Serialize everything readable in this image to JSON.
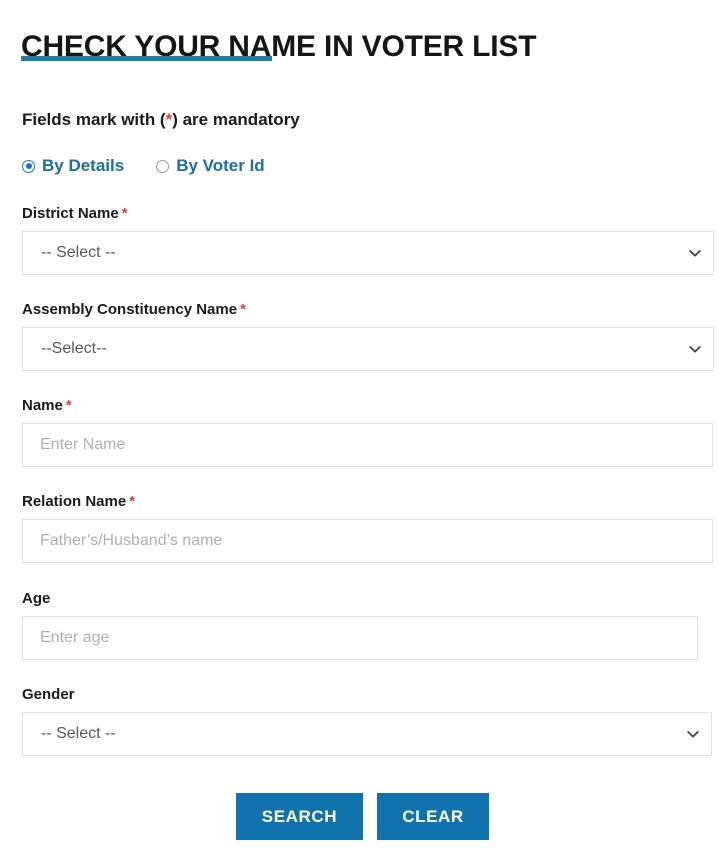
{
  "page": {
    "title": "CHECK YOUR NAME IN VOTER LIST",
    "accent_color": "#1b7fa8",
    "link_color": "#1c6ea4",
    "required_color": "#e03c3c",
    "button_color": "#1073ad"
  },
  "note": {
    "prefix": "Fields mark with (",
    "star": "*",
    "suffix": ") are mandatory"
  },
  "search_mode": {
    "options": [
      {
        "label": "By Details",
        "checked": true
      },
      {
        "label": "By Voter Id",
        "checked": false
      }
    ]
  },
  "form": {
    "fields": [
      {
        "key": "district",
        "label": "District Name",
        "required": true,
        "required_mark": "*",
        "type": "select",
        "value": "-- Select --",
        "icon": "chevron-down-icon"
      },
      {
        "key": "assembly",
        "label": "Assembly Constituency Name",
        "required": true,
        "required_mark": "*",
        "type": "select",
        "value": "--Select--",
        "icon": "chevron-down-icon"
      },
      {
        "key": "name",
        "label": "Name",
        "required": true,
        "required_mark": "*",
        "type": "text",
        "placeholder": "Enter Name",
        "value": ""
      },
      {
        "key": "relation",
        "label": "Relation Name",
        "required": true,
        "required_mark": "*",
        "type": "text",
        "placeholder": "Father’s/Husband’s name",
        "value": ""
      },
      {
        "key": "age",
        "label": "Age",
        "required": false,
        "required_mark": "",
        "type": "text",
        "placeholder": "Enter age",
        "value": ""
      },
      {
        "key": "gender",
        "label": "Gender",
        "required": false,
        "required_mark": "",
        "type": "select",
        "value": "-- Select --",
        "icon": "chevron-down-icon"
      }
    ]
  },
  "actions": {
    "search_label": "SEARCH",
    "clear_label": "CLEAR"
  }
}
